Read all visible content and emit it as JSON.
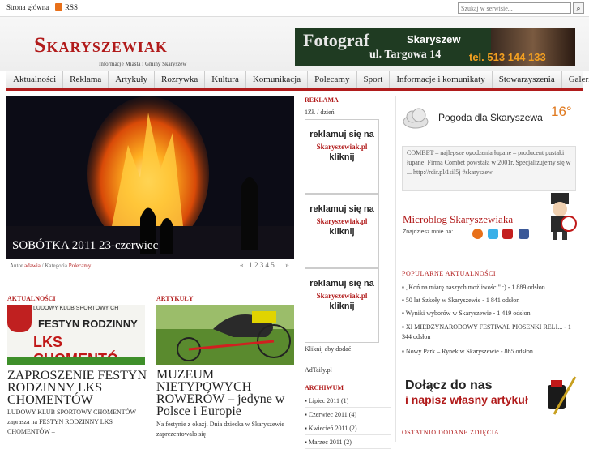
{
  "topbar": {
    "home": "Strona główna",
    "rss": "RSS",
    "search_placeholder": "Szukaj w serwisie..."
  },
  "logo": {
    "name": "Skaryszewiak",
    "tagline": "Informacje Miasta i Gminy Skaryszew"
  },
  "banner": {
    "word": "Fotograf",
    "city": "Skaryszew",
    "address": "ul. Targowa 14",
    "phone": "tel. 513 144 133"
  },
  "nav": [
    "Aktualności",
    "Reklama",
    "Artykuły",
    "Rozrywka",
    "Kultura",
    "Komunikacja",
    "Polecamy",
    "Sport",
    "Informacje i komunikaty",
    "Stowarzyszenia",
    "Galeria"
  ],
  "slider": {
    "caption": "SOBÓTKA 2011 23-czerwiec",
    "author_label": "Autor",
    "author": "adawia",
    "category_label": "Kategoria",
    "category": "Polecamy",
    "pages": [
      "«",
      "1",
      "2",
      "3",
      "4",
      "5",
      "»"
    ]
  },
  "aktualnosci": {
    "label": "AKTUALNOŚCI",
    "thumb_top": "LUDOWY KLUB SPORTOWY CH",
    "thumb_mid": "FESTYN RODZINNY",
    "thumb_big": "LKS CHOMENTÓ",
    "headline": "ZAPROSZENIE FESTYN RODZINNY LKS CHOMENTÓW",
    "body": "LUDOWY KLUB SPORTOWY CHOMENTÓW zaprasza na FESTYN RODZINNY LKS CHOMENTÓW –"
  },
  "artykuly": {
    "label": "ARTYKUŁY",
    "headline": "MUZEUM NIETYPOWYCH ROWERÓW – jedyne w Polsce i Europie",
    "body": "Na festynie z okazji Dnia dziecka w Skaryszewie zaprezentowało się"
  },
  "reklama": {
    "label": "REKLAMA",
    "price": "1Zł. / dzień",
    "ad_line1": "reklamuj się na",
    "ad_brand": "Skaryszewiak.pl",
    "ad_line3": "kliknij",
    "click_to_add": "Kliknij aby dodać",
    "adtaily": "AdTaily.pl"
  },
  "archiwum": {
    "label": "ARCHIWUM",
    "items": [
      "Lipiec 2011 (1)",
      "Czerwiec 2011 (4)",
      "Kwiecień 2011 (2)",
      "Marzec 2011 (2)"
    ]
  },
  "weather": {
    "title": "Pogoda dla Skaryszewa",
    "temp": "16°"
  },
  "combet": "COMBET – najlepsze ogodzenia łupane – producent pustaki łupane: Firma Combet powstała w 2001r. Specjalizujemy się w ... http://rdir.pl/1sil5j #skaryszew",
  "microblog": {
    "title": "Microblog Skaryszewiaka",
    "find": "Znajdziesz mnie na:"
  },
  "popularne": {
    "label": "POPULARNE AKTUALNOŚCI",
    "items": [
      "„Koń na miarę naszych możliwości\" :) - 1 889 odsłon",
      "50 lat Szkoły w Skaryszewie - 1 841 odsłon",
      "Wyniki wyborów w Skaryszewie - 1 419 odsłon",
      "XI MIĘDZYNARODOWY FESTIWAL PIOSENKI RELI... - 1 344 odsłon",
      "Nowy Park – Rynek w Skaryszewie - 865 odsłon"
    ]
  },
  "join": {
    "line1": "Dołącz do nas",
    "line2": "i napisz własny artykuł"
  },
  "ostatnio": "OSTATNIO DODANE ZDJĘCIA",
  "colors": {
    "accent": "#b11a1a",
    "orange": "#e07a20"
  }
}
